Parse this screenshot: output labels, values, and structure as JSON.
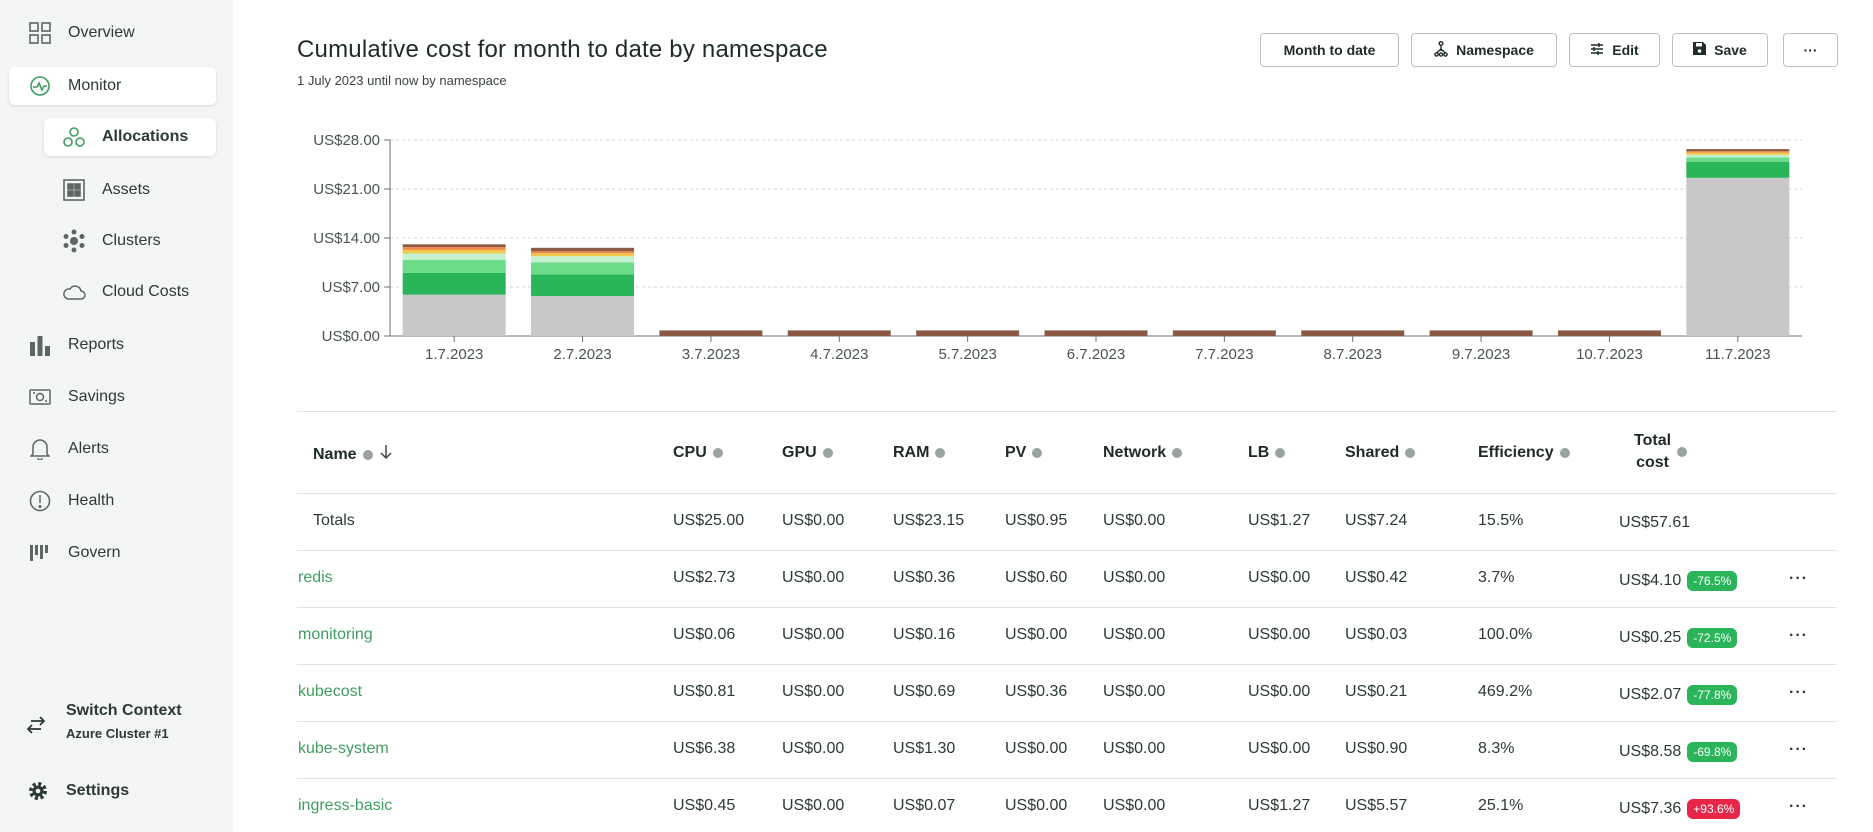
{
  "sidebar": {
    "items": [
      {
        "label": "Overview",
        "icon": "grid-icon"
      },
      {
        "label": "Monitor",
        "icon": "monitor-icon"
      },
      {
        "label": "Allocations",
        "icon": "allocations-icon"
      },
      {
        "label": "Assets",
        "icon": "assets-icon"
      },
      {
        "label": "Clusters",
        "icon": "clusters-icon"
      },
      {
        "label": "Cloud Costs",
        "icon": "cloud-icon"
      },
      {
        "label": "Reports",
        "icon": "bar-chart-icon"
      },
      {
        "label": "Savings",
        "icon": "savings-icon"
      },
      {
        "label": "Alerts",
        "icon": "bell-icon"
      },
      {
        "label": "Health",
        "icon": "health-icon"
      },
      {
        "label": "Govern",
        "icon": "govern-icon"
      }
    ],
    "switch_context": {
      "label": "Switch Context",
      "cluster": "Azure Cluster #1"
    },
    "settings": {
      "label": "Settings"
    }
  },
  "header": {
    "title": "Cumulative cost for month to date by namespace",
    "subtitle": "1 July 2023 until now by namespace",
    "buttons": {
      "month": "Month to date",
      "namespace": "Namespace",
      "edit": "Edit",
      "save": "Save",
      "more": "···"
    }
  },
  "chart_data": {
    "type": "bar",
    "stacked": true,
    "categories": [
      "1.7.2023",
      "2.7.2023",
      "3.7.2023",
      "4.7.2023",
      "5.7.2023",
      "6.7.2023",
      "7.7.2023",
      "8.7.2023",
      "9.7.2023",
      "10.7.2023",
      "11.7.2023"
    ],
    "y_ticks": [
      "US$0.00",
      "US$7.00",
      "US$14.00",
      "US$21.00",
      "US$28.00"
    ],
    "ylim": [
      0,
      28
    ],
    "grid": true,
    "series": [
      {
        "color": "#c8c8c8",
        "values": [
          5.9,
          5.7,
          0,
          0,
          0,
          0,
          0,
          0,
          0,
          0,
          22.6
        ]
      },
      {
        "color": "#2bb55a",
        "values": [
          3.1,
          3.1,
          0,
          0,
          0,
          0,
          0,
          0,
          0,
          0,
          2.3
        ]
      },
      {
        "color": "#6cdb8a",
        "values": [
          1.9,
          1.7,
          0,
          0,
          0,
          0,
          0,
          0,
          0,
          0,
          0.6
        ]
      },
      {
        "color": "#c6f2d1",
        "values": [
          0.9,
          0.9,
          0,
          0,
          0,
          0,
          0,
          0,
          0,
          0,
          0.4
        ]
      },
      {
        "color": "#f2c84a",
        "values": [
          0.5,
          0.4,
          0,
          0,
          0,
          0,
          0,
          0,
          0,
          0,
          0.3
        ]
      },
      {
        "color": "#f08a4b",
        "values": [
          0.4,
          0.3,
          0,
          0,
          0,
          0,
          0,
          0,
          0,
          0,
          0.2
        ]
      },
      {
        "color": "#8b5a45",
        "values": [
          0.4,
          0.5,
          0.8,
          0.8,
          0.8,
          0.8,
          0.8,
          0.8,
          0.8,
          0.8,
          0.3
        ]
      }
    ]
  },
  "table": {
    "columns": [
      "Name",
      "CPU",
      "GPU",
      "RAM",
      "PV",
      "Network",
      "LB",
      "Shared",
      "Efficiency",
      "Total",
      "cost"
    ],
    "totals": {
      "name": "Totals",
      "cpu": "US$25.00",
      "gpu": "US$0.00",
      "ram": "US$23.15",
      "pv": "US$0.95",
      "network": "US$0.00",
      "lb": "US$1.27",
      "shared": "US$7.24",
      "efficiency": "15.5%",
      "total": "US$57.61"
    },
    "rows": [
      {
        "name": "redis",
        "cpu": "US$2.73",
        "gpu": "US$0.00",
        "ram": "US$0.36",
        "pv": "US$0.60",
        "network": "US$0.00",
        "lb": "US$0.00",
        "shared": "US$0.42",
        "efficiency": "3.7%",
        "total": "US$4.10",
        "change": "-76.5%",
        "change_color": "#2bb55a"
      },
      {
        "name": "monitoring",
        "cpu": "US$0.06",
        "gpu": "US$0.00",
        "ram": "US$0.16",
        "pv": "US$0.00",
        "network": "US$0.00",
        "lb": "US$0.00",
        "shared": "US$0.03",
        "efficiency": "100.0%",
        "total": "US$0.25",
        "change": "-72.5%",
        "change_color": "#2bb55a"
      },
      {
        "name": "kubecost",
        "cpu": "US$0.81",
        "gpu": "US$0.00",
        "ram": "US$0.69",
        "pv": "US$0.36",
        "network": "US$0.00",
        "lb": "US$0.00",
        "shared": "US$0.21",
        "efficiency": "469.2%",
        "total": "US$2.07",
        "change": "-77.8%",
        "change_color": "#2bb55a"
      },
      {
        "name": "kube-system",
        "cpu": "US$6.38",
        "gpu": "US$0.00",
        "ram": "US$1.30",
        "pv": "US$0.00",
        "network": "US$0.00",
        "lb": "US$0.00",
        "shared": "US$0.90",
        "efficiency": "8.3%",
        "total": "US$8.58",
        "change": "-69.8%",
        "change_color": "#2bb55a"
      },
      {
        "name": "ingress-basic",
        "cpu": "US$0.45",
        "gpu": "US$0.00",
        "ram": "US$0.07",
        "pv": "US$0.00",
        "network": "US$0.00",
        "lb": "US$1.27",
        "shared": "US$5.57",
        "efficiency": "25.1%",
        "total": "US$7.36",
        "change": "+93.6%",
        "change_color": "#e8264a"
      }
    ],
    "row_menu": "···"
  },
  "colors": {
    "accent": "#3f9e5f",
    "sidebar_bg": "#f4f6f5"
  }
}
